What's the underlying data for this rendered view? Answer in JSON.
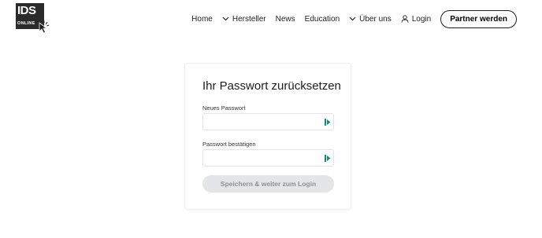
{
  "logo": {
    "brand": "IDS",
    "sub": "ONLINE"
  },
  "nav": {
    "items": [
      {
        "label": "Home",
        "has_chevron": false
      },
      {
        "label": "Hersteller",
        "has_chevron": true
      },
      {
        "label": "News",
        "has_chevron": false
      },
      {
        "label": "Education",
        "has_chevron": false
      },
      {
        "label": "Über uns",
        "has_chevron": true
      }
    ],
    "login_label": "Login",
    "partner_label": "Partner werden"
  },
  "form": {
    "title": "Ihr Passwort zurücksetzen",
    "new_password_label": "Neues Passwort",
    "new_password_value": "",
    "confirm_password_label": "Passwort bestätigen",
    "confirm_password_value": "",
    "submit_label": "Speichern & weiter zum Login"
  },
  "colors": {
    "text": "#1d1d1f",
    "button_disabled_bg": "#e4e5e8",
    "button_disabled_text": "#8e8f93",
    "password_manager_icon": "#0f8f7a"
  },
  "icons": {
    "chevron": "chevron-down-icon",
    "user": "user-icon",
    "password_manager": "password-manager-icon",
    "cursor": "cursor-icon"
  }
}
